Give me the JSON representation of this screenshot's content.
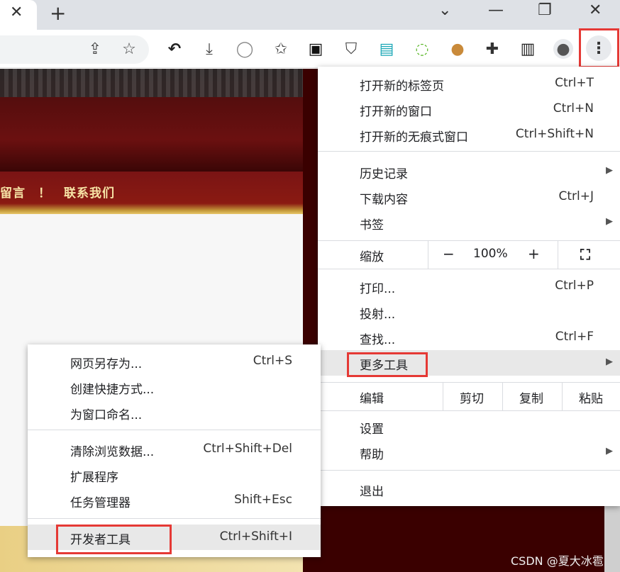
{
  "tabstrip": {
    "close_glyph": "✕",
    "newtab_glyph": "+",
    "window_controls": {
      "dropdown": "⌄",
      "minimize": "—",
      "restore": "❐",
      "close": "✕"
    }
  },
  "toolbar": {
    "icons": [
      "share-icon",
      "star-icon",
      "undo-icon",
      "download-icon",
      "circle-extension-icon",
      "star-list-icon",
      "dark-extension-icon",
      "shield-extension-icon",
      "save-extension-icon",
      "green-circle-extension-icon",
      "cookie-extension-icon",
      "puzzle-icon",
      "sidepanel-icon",
      "profile-icon",
      "kebab-menu-icon"
    ],
    "glyphs": {
      "share": "⇪",
      "star": "☆",
      "undo": "↶",
      "download": "⤓",
      "circle": "◯",
      "starlist": "✩",
      "dark": "▣",
      "shield": "⛉",
      "save": "▤",
      "green": "◌",
      "cookie": "●",
      "puzzle": "✚",
      "sidepanel": "▥",
      "profile": "●",
      "kebab": "⋮"
    },
    "accent": "#e53935"
  },
  "page": {
    "nav_text": "留言　！　联系我们"
  },
  "menu": {
    "items_top": [
      {
        "label": "打开新的标签页",
        "shortcut": "Ctrl+T"
      },
      {
        "label": "打开新的窗口",
        "shortcut": "Ctrl+N"
      },
      {
        "label": "打开新的无痕式窗口",
        "shortcut": "Ctrl+Shift+N"
      }
    ],
    "items_history": [
      {
        "label": "历史记录",
        "shortcut": "",
        "arrow": "▶"
      },
      {
        "label": "下载内容",
        "shortcut": "Ctrl+J"
      },
      {
        "label": "书签",
        "shortcut": "",
        "arrow": "▶"
      }
    ],
    "zoom": {
      "label": "缩放",
      "minus": "−",
      "value": "100%",
      "plus": "+",
      "fullscreen": "⛶"
    },
    "items_print": [
      {
        "label": "打印...",
        "shortcut": "Ctrl+P"
      },
      {
        "label": "投射...",
        "shortcut": ""
      },
      {
        "label": "查找...",
        "shortcut": "Ctrl+F"
      },
      {
        "label": "更多工具",
        "shortcut": "",
        "arrow": "▶"
      }
    ],
    "edit": {
      "label": "编辑",
      "cut": "剪切",
      "copy": "复制",
      "paste": "粘贴"
    },
    "items_settings": [
      {
        "label": "设置",
        "shortcut": ""
      },
      {
        "label": "帮助",
        "shortcut": "",
        "arrow": "▶"
      }
    ],
    "exit": {
      "label": "退出"
    }
  },
  "submenu": {
    "items_a": [
      {
        "label": "网页另存为...",
        "shortcut": "Ctrl+S"
      },
      {
        "label": "创建快捷方式...",
        "shortcut": ""
      },
      {
        "label": "为窗口命名...",
        "shortcut": ""
      }
    ],
    "items_b": [
      {
        "label": "清除浏览数据...",
        "shortcut": "Ctrl+Shift+Del"
      },
      {
        "label": "扩展程序",
        "shortcut": ""
      },
      {
        "label": "任务管理器",
        "shortcut": "Shift+Esc"
      }
    ],
    "devtools": {
      "label": "开发者工具",
      "shortcut": "Ctrl+Shift+I"
    }
  },
  "watermark": "CSDN @夏大冰雹"
}
